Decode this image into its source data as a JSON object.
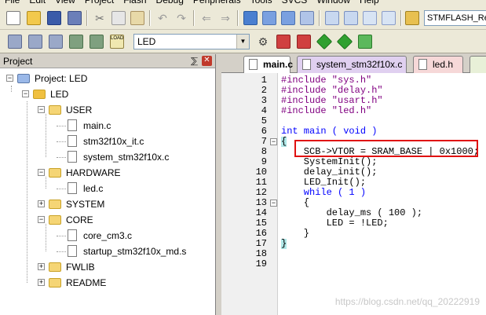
{
  "menu": [
    "File",
    "Edit",
    "View",
    "Project",
    "Flash",
    "Debug",
    "Peripherals",
    "Tools",
    "SVCS",
    "Window",
    "Help"
  ],
  "toolbar": {
    "target_name": "STMFLASH_Rea",
    "project_select": "LED"
  },
  "project_panel": {
    "title": "Project",
    "pin_glyph": "⅀",
    "close_glyph": "✕",
    "tree": [
      {
        "label": "Project: LED",
        "kind": "project",
        "depth": 0,
        "expanded": true
      },
      {
        "label": "LED",
        "kind": "target",
        "depth": 1,
        "expanded": true
      },
      {
        "label": "USER",
        "kind": "folder",
        "depth": 2,
        "expanded": true
      },
      {
        "label": "main.c",
        "kind": "file",
        "depth": 3
      },
      {
        "label": "stm32f10x_it.c",
        "kind": "file",
        "depth": 3
      },
      {
        "label": "system_stm32f10x.c",
        "kind": "file",
        "depth": 3
      },
      {
        "label": "HARDWARE",
        "kind": "folder",
        "depth": 2,
        "expanded": true
      },
      {
        "label": "led.c",
        "kind": "file",
        "depth": 3
      },
      {
        "label": "SYSTEM",
        "kind": "folder",
        "depth": 2,
        "expanded": false
      },
      {
        "label": "CORE",
        "kind": "folder",
        "depth": 2,
        "expanded": true
      },
      {
        "label": "core_cm3.c",
        "kind": "file",
        "depth": 3
      },
      {
        "label": "startup_stm32f10x_md.s",
        "kind": "file",
        "depth": 3
      },
      {
        "label": "FWLIB",
        "kind": "folder",
        "depth": 2,
        "expanded": false
      },
      {
        "label": "README",
        "kind": "folder",
        "depth": 2,
        "expanded": false
      }
    ]
  },
  "tabs": [
    {
      "label": "main.c",
      "active": true
    },
    {
      "label": "system_stm32f10x.c",
      "active": false
    },
    {
      "label": "led.h",
      "active": false
    }
  ],
  "editor": {
    "line_numbers": [
      "1",
      "2",
      "3",
      "4",
      "5",
      "6",
      "7",
      "8",
      "9",
      "10",
      "11",
      "12",
      "13",
      "14",
      "15",
      "16",
      "17",
      "18",
      "19"
    ],
    "lines": [
      "#include \"sys.h\"",
      "#include \"delay.h\"",
      "#include \"usart.h\"",
      "#include \"led.h\"",
      "",
      "int main ( void )",
      "{",
      "    SCB->VTOR = SRAM_BASE | 0x1000;",
      "    SystemInit();",
      "    delay_init();",
      "    LED_Init();",
      "    while ( 1 )",
      "    {",
      "        delay_ms ( 100 );",
      "        LED = !LED;",
      "    }",
      "}",
      "",
      ""
    ]
  },
  "watermark": "https://blog.csdn.net/qq_20222919",
  "colors": {
    "keyword": "#0000ff",
    "string": "#800000",
    "preprocessor": "#800080",
    "highlight_box": "#e01010"
  }
}
